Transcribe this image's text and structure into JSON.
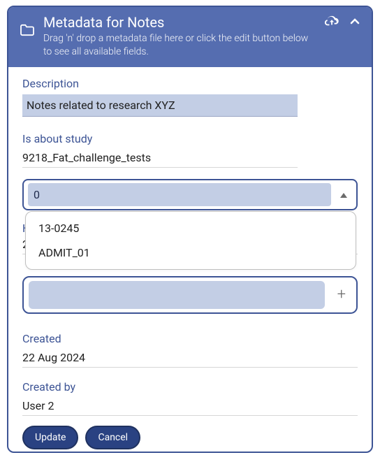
{
  "header": {
    "title": "Metadata for Notes",
    "subtitle": "Drag 'n' drop a metadata file here or click the edit button below to see all available fields."
  },
  "fields": {
    "description": {
      "label": "Description",
      "value": "Notes related to research XYZ"
    },
    "study": {
      "label": "Is about study",
      "value": "9218_Fat_challenge_tests"
    },
    "combo_search": {
      "value": "0"
    },
    "dropdown_options": [
      "13-0245",
      "ADMIT_01"
    ],
    "hidden": {
      "label_fragment": "H",
      "value_fragment": "2"
    },
    "created": {
      "label": "Created",
      "value": "22 Aug 2024"
    },
    "created_by": {
      "label": "Created by",
      "value": "User 2"
    }
  },
  "buttons": {
    "update": "Update",
    "cancel": "Cancel"
  }
}
